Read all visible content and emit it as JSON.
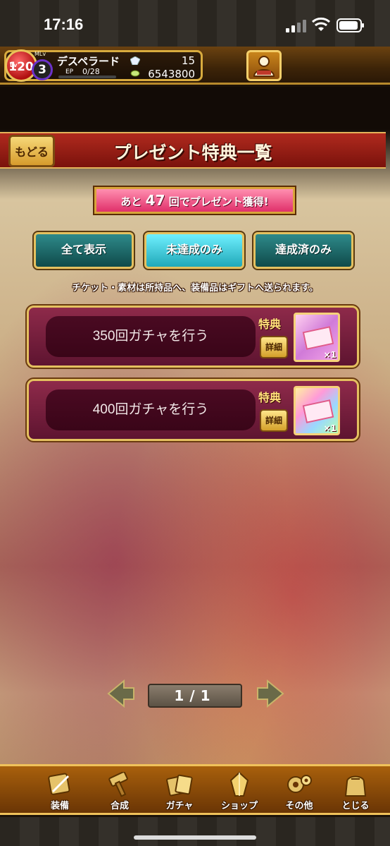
{
  "status_bar": {
    "time": "17:16"
  },
  "player": {
    "lv_tag": "Lv",
    "level": "120",
    "mlv_tag": "MLv",
    "master_level": "3",
    "name": "デスペラード",
    "ep_label": "EP",
    "ep_value": "0/28",
    "ep_progress": 0,
    "gems": "15",
    "coins": "6543800"
  },
  "header": {
    "back_label": "もどる",
    "title": "プレゼント特典一覧"
  },
  "counter_banner": {
    "prefix": "あと",
    "count": "47",
    "suffix": "回でプレゼント獲得!"
  },
  "filters": {
    "all": "全て表示",
    "incomplete": "未達成のみ",
    "complete": "達成済のみ",
    "selected": "incomplete"
  },
  "notice": "チケット・素材は所持品へ、装備品はギフトへ送られます。",
  "rewards": [
    {
      "mission": "350回ガチャを行う",
      "tokuten_label": "特典",
      "detail_label": "詳細",
      "qty": "×1"
    },
    {
      "mission": "400回ガチャを行う",
      "tokuten_label": "特典",
      "detail_label": "詳細",
      "qty": "×1"
    }
  ],
  "pager": {
    "current": "1",
    "separator": "/",
    "total": "1"
  },
  "bottom_nav": [
    {
      "label": "装備",
      "icon": "equipment-icon"
    },
    {
      "label": "合成",
      "icon": "hammer-icon"
    },
    {
      "label": "ガチャ",
      "icon": "gacha-icon"
    },
    {
      "label": "ショップ",
      "icon": "crystal-icon"
    },
    {
      "label": "その他",
      "icon": "gears-icon"
    },
    {
      "label": "とじる",
      "icon": "close-bag-icon"
    }
  ],
  "colors": {
    "accent_gold": "#e4c060",
    "ribbon_red": "#b02a1e",
    "card_crimson": "#8e2a4a",
    "filter_teal": "#2e8a8a",
    "filter_selected": "#6ff0ff"
  }
}
